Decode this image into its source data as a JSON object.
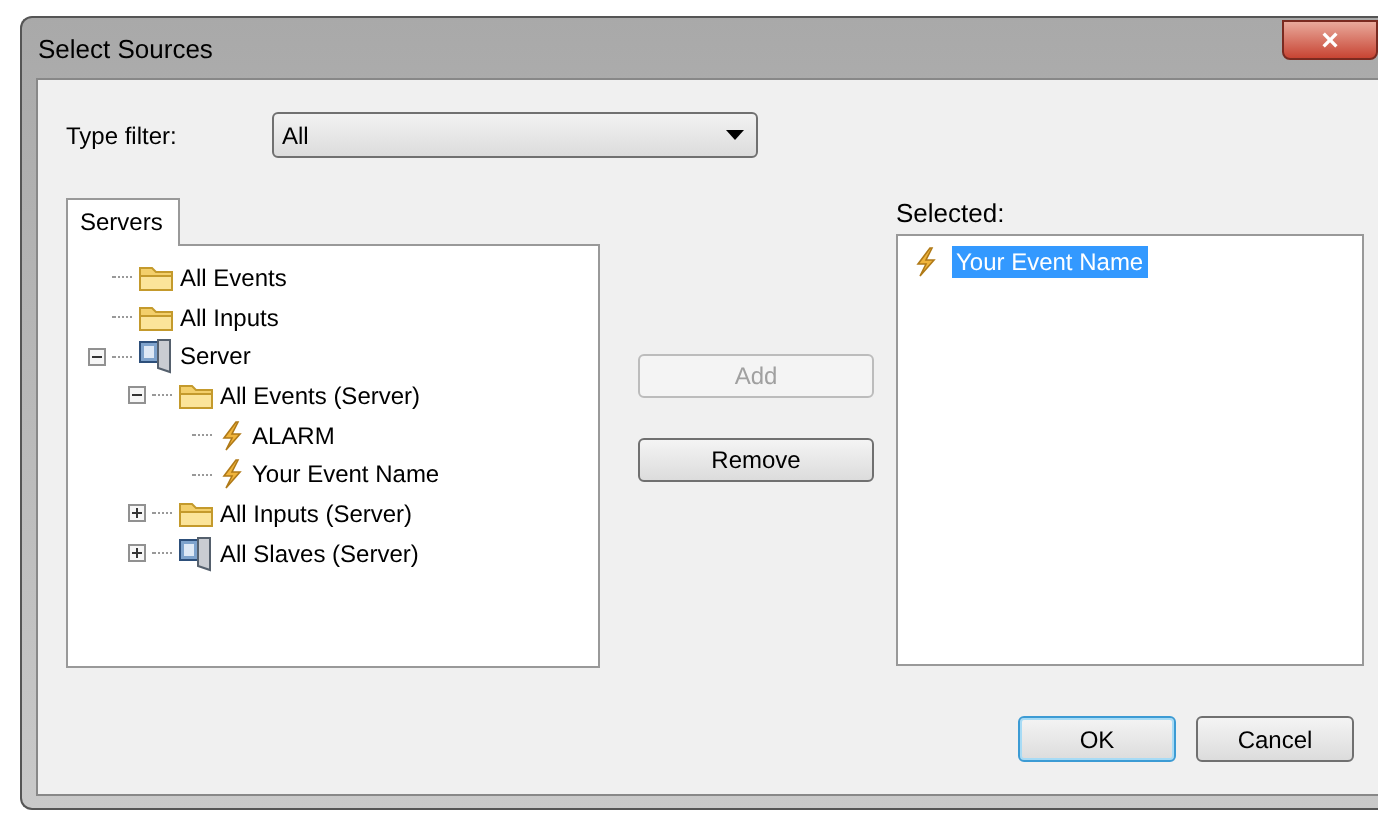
{
  "window": {
    "title": "Select Sources",
    "close": "×"
  },
  "type_filter": {
    "label": "Type filter:",
    "value": "All"
  },
  "tabs": [
    {
      "label": "Servers",
      "selected": true
    }
  ],
  "tree": [
    {
      "label": "All Events",
      "kind": "folder"
    },
    {
      "label": "All Inputs",
      "kind": "folder"
    },
    {
      "label": "Server",
      "kind": "server",
      "expanded": true,
      "children": [
        {
          "label": "All Events (Server)",
          "kind": "folder",
          "expanded": true,
          "children": [
            {
              "label": "ALARM",
              "kind": "event"
            },
            {
              "label": "Your Event Name",
              "kind": "event"
            }
          ]
        },
        {
          "label": "All Inputs (Server)",
          "kind": "folder",
          "expanded": false
        },
        {
          "label": "All Slaves (Server)",
          "kind": "server",
          "expanded": false
        }
      ]
    }
  ],
  "add_button": {
    "label": "Add",
    "disabled": true
  },
  "remove_button": {
    "label": "Remove",
    "disabled": false
  },
  "selected_list": {
    "label": "Selected:",
    "items": [
      {
        "label": "Your Event Name",
        "kind": "event",
        "selected": true
      }
    ]
  },
  "buttons": [
    {
      "label": "OK",
      "default": true
    },
    {
      "label": "Cancel",
      "default": false
    }
  ]
}
